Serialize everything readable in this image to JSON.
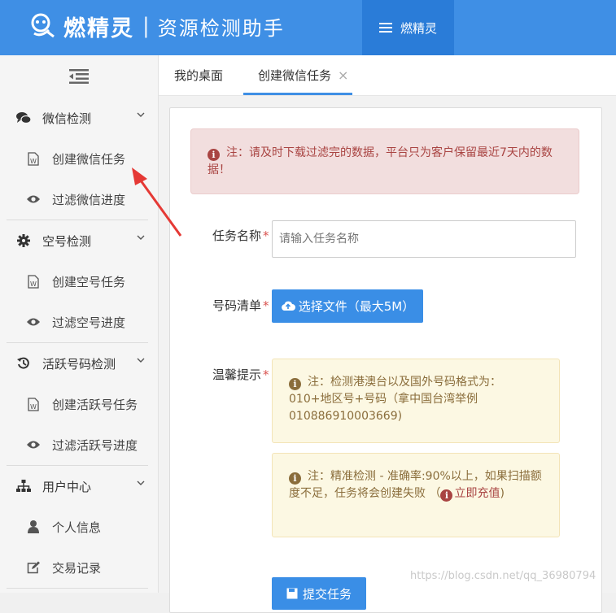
{
  "header": {
    "logo_name": "燃精灵",
    "separator": "|",
    "subtitle": "资源检测助手",
    "menu_label": "燃精灵"
  },
  "sidebar": {
    "groups": [
      {
        "label": "微信检测",
        "icon": "chat-icon",
        "items": [
          {
            "label": "创建微信任务",
            "icon": "word-document-icon"
          },
          {
            "label": "过滤微信进度",
            "icon": "eye-icon"
          }
        ]
      },
      {
        "label": "空号检测",
        "icon": "gear-icon",
        "items": [
          {
            "label": "创建空号任务",
            "icon": "word-document-icon"
          },
          {
            "label": "过滤空号进度",
            "icon": "eye-icon"
          }
        ]
      },
      {
        "label": "活跃号码检测",
        "icon": "history-icon",
        "items": [
          {
            "label": "创建活跃号任务",
            "icon": "word-document-icon"
          },
          {
            "label": "过滤活跃号进度",
            "icon": "eye-icon"
          }
        ]
      },
      {
        "label": "用户中心",
        "icon": "sitemap-icon",
        "items": [
          {
            "label": "个人信息",
            "icon": "user-icon"
          },
          {
            "label": "交易记录",
            "icon": "edit-icon"
          }
        ]
      }
    ]
  },
  "tabs": [
    {
      "label": "我的桌面",
      "active": false
    },
    {
      "label": "创建微信任务",
      "active": true,
      "close": "×"
    }
  ],
  "form": {
    "alert_red": "注：请及时下载过滤完的数据，平台只为客户保留最近7天内的数据！",
    "task_name_label": "任务名称",
    "task_name_placeholder": "请输入任务名称",
    "required_mark": "*",
    "number_list_label": "号码清单",
    "upload_button": "选择文件（最大5M）",
    "tip_label": "温馨提示",
    "tip1": "注：检测港澳台以及国外号码格式为：010+地区号+号码（拿中国台湾举例010886910003669)",
    "tip2_text": "注：精准检测 - 准确率:90%以上，如果扫描额度不足，任务将会创建失败 （",
    "tip2_link": "立即充值",
    "tip2_end": ")",
    "submit_button": "提交任务"
  },
  "watermark": "https://blog.csdn.net/qq_36980794",
  "colors": {
    "header": "#3f8fe5",
    "primary_button": "#3a8ee6",
    "alert_red_bg": "#f2dede",
    "alert_yellow_bg": "#fcf8e3",
    "annotation_arrow": "#e53935"
  }
}
